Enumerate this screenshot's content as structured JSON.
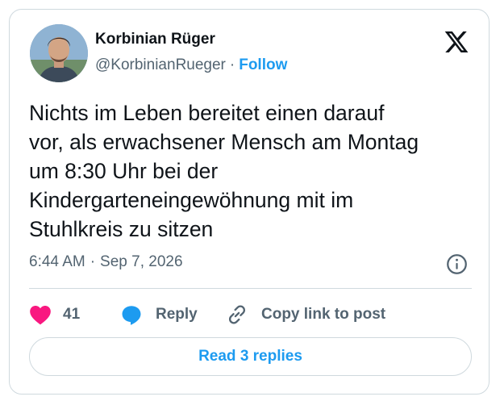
{
  "author": {
    "name": "Korbinian Rüger",
    "handle": "@KorbinianRueger",
    "separator": "·",
    "follow_label": "Follow",
    "avatar_icon": "avatar-photo"
  },
  "brand": {
    "logo_icon": "x-logo-icon"
  },
  "tweet": {
    "lines": [
      "Nichts im Leben bereitet einen darauf",
      "vor, als erwachsener Mensch am Montag",
      "um 8:30 Uhr bei der",
      "Kindergarteneingewöhnung mit im",
      "Stuhlkreis zu sitzen"
    ],
    "time": "6:44 AM",
    "date_separator": "·",
    "date": "Sep 7, 2026",
    "info_icon": "info-icon"
  },
  "actions": {
    "like_icon": "heart-icon",
    "like_count": "41",
    "reply_icon": "speech-bubble-icon",
    "reply_label": "Reply",
    "copy_icon": "link-icon",
    "copy_label": "Copy link to post"
  },
  "replies_button": {
    "label": "Read 3 replies"
  },
  "colors": {
    "text": "#0f1419",
    "secondary": "#536471",
    "accent": "#1d9bf0",
    "like": "#f91880",
    "border": "#cfd9de"
  }
}
